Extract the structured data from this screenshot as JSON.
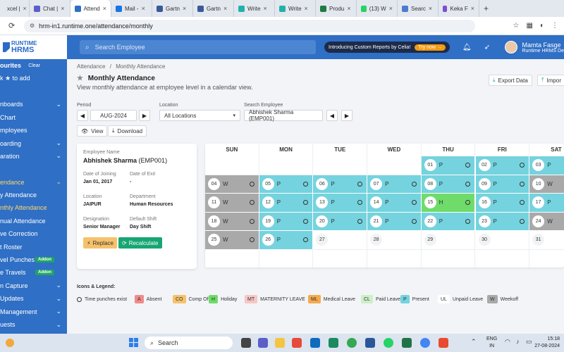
{
  "browser": {
    "tabs": [
      {
        "label": "xcel |",
        "color": "#1f7a44"
      },
      {
        "label": "Chat |",
        "color": "#5b5fc7"
      },
      {
        "label": "Attend",
        "color": "#2f6fc5",
        "active": true
      },
      {
        "label": "Mail -",
        "color": "#1a73e8"
      },
      {
        "label": "Gartn",
        "color": "#3b5998"
      },
      {
        "label": "Gartn",
        "color": "#3b5998"
      },
      {
        "label": "Write",
        "color": "#20b2aa"
      },
      {
        "label": "Write",
        "color": "#20b2aa"
      },
      {
        "label": "Produ",
        "color": "#1f7a44"
      },
      {
        "label": "(13) W",
        "color": "#25d366"
      },
      {
        "label": "Searc",
        "color": "#4a7bd0"
      },
      {
        "label": "Keka F",
        "color": "#7a4fd0"
      }
    ],
    "url": "hrm-in1.runtime.one/attendance/monthly"
  },
  "header": {
    "logo_line1": "RUNTIME",
    "logo_line2": "HRMS",
    "search_placeholder": "Search Employee",
    "promo_text": "Introducing Custom Reports by Celia!",
    "promo_cta": "Try now →",
    "user_name": "Mamta Fasge",
    "user_org": "Runtime HRMS De"
  },
  "sidebar": {
    "items": [
      {
        "label": "ourites",
        "extra": "Clear"
      },
      {
        "label": "k ★ to add"
      },
      {
        "label": ""
      },
      {
        "label": "nboards",
        "chev": true
      },
      {
        "label": "Chart"
      },
      {
        "label": "mployees"
      },
      {
        "label": "oarding",
        "chev": true
      },
      {
        "label": "aration",
        "chev": true
      },
      {
        "label": ""
      },
      {
        "label": "endance",
        "chev": true,
        "active": true
      },
      {
        "label": "y Attendance"
      },
      {
        "label": "nthly Attendance",
        "active": true
      },
      {
        "label": "nual Attendance"
      },
      {
        "label": "ve Correction"
      },
      {
        "label": "t Roster"
      },
      {
        "label": "vel Punches",
        "addon": "Addon"
      },
      {
        "label": "e Travels",
        "addon": "Addon"
      },
      {
        "label": "n Capture",
        "chev": true
      },
      {
        "label": " Updates",
        "chev": true
      },
      {
        "label": "Management",
        "chev": true
      },
      {
        "label": "uests",
        "chev": true
      }
    ]
  },
  "page": {
    "breadcrumb_root": "Attendance",
    "breadcrumb_sep": "/",
    "breadcrumb_current": "Monthly Attendance",
    "title": "Monthly Attendance",
    "subtitle": "View monthly attendance at employee level in a calendar view.",
    "export_label": "Export Data",
    "import_label": "Impor",
    "period_label": "Period",
    "period_value": "AUG-2024",
    "location_label": "Location",
    "location_value": "All Locations",
    "search_employee_label": "Search Employee",
    "search_employee_value": "Abhishek Sharma (EMP001)",
    "view_label": "View",
    "download_label": "Download"
  },
  "employee": {
    "name_label": "Employee Name",
    "name": "Abhishek Sharma",
    "code": "(EMP001)",
    "doj_label": "Date of Joining",
    "doj": "Jan 01, 2017",
    "doe_label": "Date of Exit",
    "doe": "-",
    "location_label": "Location",
    "location": "JAIPUR",
    "department_label": "Department",
    "department": "Human Resources",
    "designation_label": "Designation",
    "designation": "Senior Manager",
    "shift_label": "Default Shift",
    "shift": "Day Shift",
    "replace_label": "Replace",
    "recalc_label": "Recalculate"
  },
  "calendar": {
    "days": [
      "SUN",
      "MON",
      "TUE",
      "WED",
      "THU",
      "FRI",
      "SAT"
    ],
    "cells": [
      {
        "row": 0,
        "col": 4,
        "day": "01",
        "status": "P"
      },
      {
        "row": 0,
        "col": 5,
        "day": "02",
        "status": "P"
      },
      {
        "row": 0,
        "col": 6,
        "day": "03",
        "status": "P"
      },
      {
        "row": 1,
        "col": 0,
        "day": "04",
        "status": "W"
      },
      {
        "row": 1,
        "col": 1,
        "day": "05",
        "status": "P"
      },
      {
        "row": 1,
        "col": 2,
        "day": "06",
        "status": "P"
      },
      {
        "row": 1,
        "col": 3,
        "day": "07",
        "status": "P"
      },
      {
        "row": 1,
        "col": 4,
        "day": "08",
        "status": "P"
      },
      {
        "row": 1,
        "col": 5,
        "day": "09",
        "status": "P"
      },
      {
        "row": 1,
        "col": 6,
        "day": "10",
        "status": "W"
      },
      {
        "row": 2,
        "col": 0,
        "day": "11",
        "status": "W"
      },
      {
        "row": 2,
        "col": 1,
        "day": "12",
        "status": "P"
      },
      {
        "row": 2,
        "col": 2,
        "day": "13",
        "status": "P"
      },
      {
        "row": 2,
        "col": 3,
        "day": "14",
        "status": "P"
      },
      {
        "row": 2,
        "col": 4,
        "day": "15",
        "status": "H"
      },
      {
        "row": 2,
        "col": 5,
        "day": "16",
        "status": "P"
      },
      {
        "row": 2,
        "col": 6,
        "day": "17",
        "status": "P"
      },
      {
        "row": 3,
        "col": 0,
        "day": "18",
        "status": "W"
      },
      {
        "row": 3,
        "col": 1,
        "day": "19",
        "status": "P"
      },
      {
        "row": 3,
        "col": 2,
        "day": "20",
        "status": "P"
      },
      {
        "row": 3,
        "col": 3,
        "day": "21",
        "status": "P"
      },
      {
        "row": 3,
        "col": 4,
        "day": "22",
        "status": "P"
      },
      {
        "row": 3,
        "col": 5,
        "day": "23",
        "status": "P"
      },
      {
        "row": 3,
        "col": 6,
        "day": "24",
        "status": "W"
      },
      {
        "row": 4,
        "col": 0,
        "day": "25",
        "status": "W"
      },
      {
        "row": 4,
        "col": 1,
        "day": "26",
        "status": "P"
      },
      {
        "row": 4,
        "col": 2,
        "day": "27",
        "status": ""
      },
      {
        "row": 4,
        "col": 3,
        "day": "28",
        "status": ""
      },
      {
        "row": 4,
        "col": 4,
        "day": "29",
        "status": ""
      },
      {
        "row": 4,
        "col": 5,
        "day": "30",
        "status": ""
      },
      {
        "row": 4,
        "col": 6,
        "day": "31",
        "status": ""
      }
    ],
    "status_colors": {
      "P": "#74d3de",
      "W": "#a9a9a9",
      "H": "#6fdb6a",
      "": "#ffffff"
    }
  },
  "legend": {
    "title": "Icons & Legend:",
    "time_punch_label": "Time punches exist",
    "items": [
      {
        "code": "A",
        "label": "Absent",
        "color": "#f08a8a"
      },
      {
        "code": "CO",
        "label": "Comp Off",
        "color": "#f5c26b"
      },
      {
        "code": "H",
        "label": "Holiday",
        "color": "#6fdb6a"
      },
      {
        "code": "MT",
        "label": "MATERNITY LEAVE",
        "color": "#f7c6c6"
      },
      {
        "code": "ML",
        "label": "Medical Leave",
        "color": "#f5a94e"
      },
      {
        "code": "CL",
        "label": "Paid Leave",
        "color": "#cdeecb"
      },
      {
        "code": "P",
        "label": "Present",
        "color": "#74d3de"
      },
      {
        "code": "UL",
        "label": "Unpaid Leave",
        "color": "#ffffff"
      },
      {
        "code": "W",
        "label": "Weekoff",
        "color": "#a9a9a9"
      }
    ]
  },
  "taskbar": {
    "search_label": "Search",
    "lang1": "ENG",
    "lang2": "IN",
    "time": "15:18",
    "date": "27-08-2024"
  }
}
